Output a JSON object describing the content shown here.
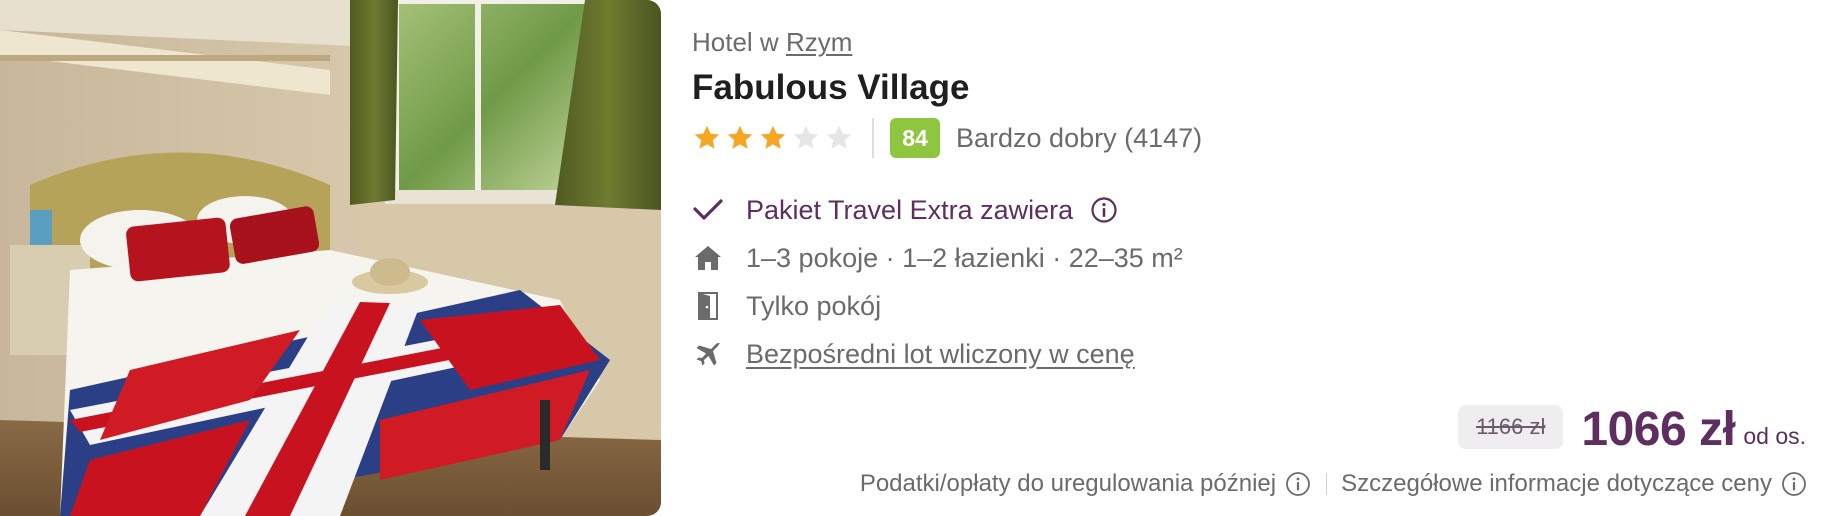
{
  "photo": {
    "alt": "Hotel room with double bed and Union Jack bedspread"
  },
  "location": {
    "prefix": "Hotel w",
    "city": "Rzym"
  },
  "hotel": {
    "name": "Fabulous Village"
  },
  "rating": {
    "stars_filled": 3,
    "stars_total": 5,
    "score": "84",
    "label": "Bardzo dobry (4147)"
  },
  "features": {
    "package": "Pakiet Travel Extra zawiera",
    "rooms": "1–3 pokoje · 1–2 łazienki · 22–35 m²",
    "board": "Tylko pokój",
    "flight": "Bezpośredni lot wliczony w cenę"
  },
  "price": {
    "old": "1166 zł",
    "current": "1066 zł",
    "per_person": "od os."
  },
  "footer": {
    "taxes_note": "Podatki/opłaty do uregulowania później",
    "price_details": "Szczegółowe informacje dotyczące ceny"
  },
  "colors": {
    "brand_purple": "#5d2e5f",
    "score_green": "#8ec63f",
    "star_gold": "#f5a623",
    "star_empty": "#e6e6e6",
    "muted_text": "#6b6b6b"
  },
  "icons": {
    "package": "checkmark-icon",
    "rooms": "house-icon",
    "board": "door-icon",
    "flight": "plane-icon",
    "info": "info-icon"
  }
}
